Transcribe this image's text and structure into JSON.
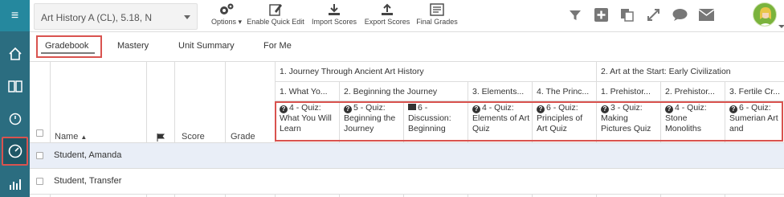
{
  "toolbar": {
    "course": "Art History A (CL), 5.18, N",
    "options": "Options",
    "quick_edit": "Enable Quick Edit",
    "import": "Import Scores",
    "export": "Export Scores",
    "final": "Final Grades"
  },
  "tabs": [
    "Gradebook",
    "Mastery",
    "Unit Summary",
    "For Me"
  ],
  "columns": {
    "name": "Name",
    "score": "Score",
    "grade": "Grade"
  },
  "units": [
    "1. Journey Through Ancient Art History",
    "2. Art at the Start: Early Civilization"
  ],
  "lessons": [
    "1. What Yo...",
    "2. Beginning the Journey",
    "3. Elements...",
    "4. The Princ...",
    "1. Prehistor...",
    "2. Prehistor...",
    "3. Fertile Cr..."
  ],
  "assignments": [
    {
      "num": "4 - Quiz:",
      "rest": "What You Will Learn"
    },
    {
      "num": "5 - Quiz:",
      "rest": "Beginning the Journey"
    },
    {
      "num": "6 -",
      "rest": "Discussion: Beginning"
    },
    {
      "num": "4 - Quiz:",
      "rest": "Elements of Art Quiz"
    },
    {
      "num": "6 - Quiz:",
      "rest": "Principles of Art Quiz"
    },
    {
      "num": "3 - Quiz:",
      "rest": "Making Pictures Quiz"
    },
    {
      "num": "4 - Quiz:",
      "rest": "Stone Monoliths"
    },
    {
      "num": "6 - Quiz:",
      "rest": "Sumerian Art and"
    }
  ],
  "students": [
    "Student, Amanda",
    "Student, Transfer"
  ],
  "colors": {
    "rail": "#2b6d80",
    "highlight": "#d9534f",
    "row_selected": "#e9eef7"
  }
}
